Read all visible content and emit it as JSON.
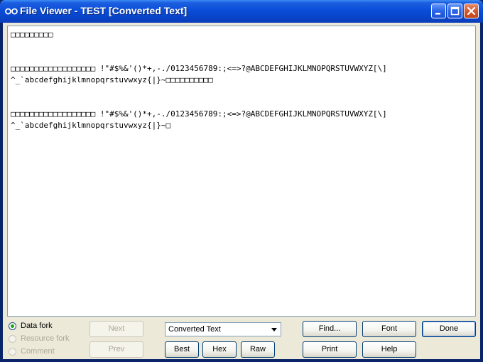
{
  "window": {
    "title": "File Viewer - TEST [Converted Text]",
    "colors": {
      "titlebar": "#0a4dd8",
      "face": "#ece9d8",
      "close": "#d5582d"
    }
  },
  "viewer": {
    "content": "□□□□□□□□□\n\n\n□□□□□□□□□□□□□□□□□□ !\"#$%&'()*+,-./0123456789:;<=>?@ABCDEFGHIJKLMNOPQRSTUVWXYZ[\\]\n^_`abcdefghijklmnopqrstuvwxyz{|}~□□□□□□□□□□\n\n\n□□□□□□□□□□□□□□□□□□ !\"#$%&'()*+,-./0123456789:;<=>?@ABCDEFGHIJKLMNOPQRSTUVWXYZ[\\]\n^_`abcdefghijklmnopqrstuvwxyz{|}~□"
  },
  "fork": {
    "options": [
      {
        "label": "Data fork",
        "selected": true,
        "enabled": true
      },
      {
        "label": "Resource fork",
        "selected": false,
        "enabled": false
      },
      {
        "label": "Comment",
        "selected": false,
        "enabled": false
      }
    ]
  },
  "nav": {
    "next": "Next",
    "prev": "Prev"
  },
  "mode_select": {
    "value": "Converted Text"
  },
  "view_buttons": {
    "best": "Best",
    "hex": "Hex",
    "raw": "Raw"
  },
  "actions": {
    "find": "Find...",
    "font": "Font",
    "done": "Done",
    "print": "Print",
    "help": "Help"
  }
}
